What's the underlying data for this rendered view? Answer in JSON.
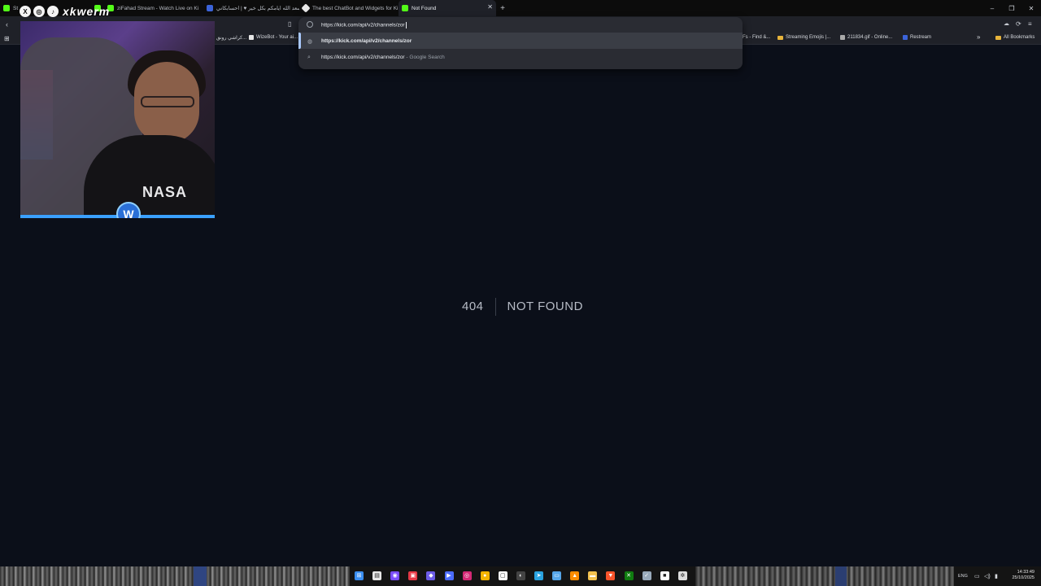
{
  "tabs": [
    {
      "label": "St",
      "fav_color": "#53fc18"
    },
    {
      "label": "d",
      "fav_color": "#53fc18"
    },
    {
      "label": "ziFahad Stream - Watch Live on Ki",
      "fav_color": "#53fc18"
    },
    {
      "label": "اسعد الله ايامكم بكل خير ♥ | احسابكاني",
      "fav_color": "#3b63d9"
    },
    {
      "label": "The best ChatBot and Widgets for Ki",
      "fav_color": "#e6e6e6"
    },
    {
      "label": "Not Found",
      "fav_color": "#53fc18"
    }
  ],
  "window": {
    "new_tab": "+",
    "minimize": "–",
    "restore": "❐",
    "close": "✕"
  },
  "omnibox": {
    "value": "https://kick.com/api/v2/channels/zor",
    "suggestions": [
      {
        "text": "https://kick.com/api/v2/channels/zor",
        "suffix": "",
        "icon": "globe-icon"
      },
      {
        "text": "https://kick.com/api/v2/channels/zor",
        "suffix": " - Google Search",
        "icon": "search-icon"
      }
    ]
  },
  "bookmarks": [
    {
      "label": "كراشي رونق...",
      "color": "#d33"
    },
    {
      "label": "WizeBot - Your ai...",
      "color": "#e6e6e6"
    },
    {
      "label": "Fs - Find &...",
      "color": "#777"
    },
    {
      "label": "Streaming Emojis |...",
      "color": "#e7b43b"
    },
    {
      "label": "211834.gif - Online...",
      "color": "#aaa"
    },
    {
      "label": "Restream",
      "color": "#3b63d9"
    },
    {
      "label": "All Bookmarks",
      "color": "#e7b43b"
    }
  ],
  "page": {
    "code": "404",
    "message": "NOT FOUND"
  },
  "overlay": {
    "handle": "xkwerm",
    "social_icons": [
      "x-icon",
      "instagram-icon",
      "tiktok-icon"
    ],
    "shirt_text": "NASA",
    "logo_letter": "W"
  },
  "taskbar": {
    "icons": [
      {
        "name": "windows-start-icon",
        "color": "#3a8ef0",
        "glyph": "⊞"
      },
      {
        "name": "file-icon",
        "color": "#e8e8e8",
        "glyph": "▤"
      },
      {
        "name": "messenger-icon",
        "color": "#7b4dff",
        "glyph": "◉"
      },
      {
        "name": "app-red-icon",
        "color": "#e63946",
        "glyph": "▣"
      },
      {
        "name": "gem-icon",
        "color": "#6c5ce7",
        "glyph": "◆"
      },
      {
        "name": "media-icon",
        "color": "#4b6cff",
        "glyph": "▶"
      },
      {
        "name": "instagram-icon",
        "color": "#d62976",
        "glyph": "◎"
      },
      {
        "name": "chrome-icon",
        "color": "#f4b400",
        "glyph": "●"
      },
      {
        "name": "app-icon",
        "color": "#ffffff",
        "glyph": "▢"
      },
      {
        "name": "obs-icon",
        "color": "#444",
        "glyph": "◐"
      },
      {
        "name": "telegram-icon",
        "color": "#2aa3e0",
        "glyph": "➤"
      },
      {
        "name": "display-icon",
        "color": "#56a6e8",
        "glyph": "▭"
      },
      {
        "name": "vlc-icon",
        "color": "#ff8c00",
        "glyph": "▲"
      },
      {
        "name": "folder-icon",
        "color": "#f2c14e",
        "glyph": "▬"
      },
      {
        "name": "brave-icon",
        "color": "#fb542b",
        "glyph": "▼"
      },
      {
        "name": "xbox-icon",
        "color": "#107c10",
        "glyph": "✕"
      },
      {
        "name": "steam-icon",
        "color": "#9ab",
        "glyph": "✓"
      },
      {
        "name": "game-icon",
        "color": "#fff",
        "glyph": "■"
      },
      {
        "name": "settings-icon",
        "color": "#ddd",
        "glyph": "✲"
      }
    ],
    "lang": "ENG",
    "time": "14:33:49",
    "date": "25/10/2025"
  }
}
